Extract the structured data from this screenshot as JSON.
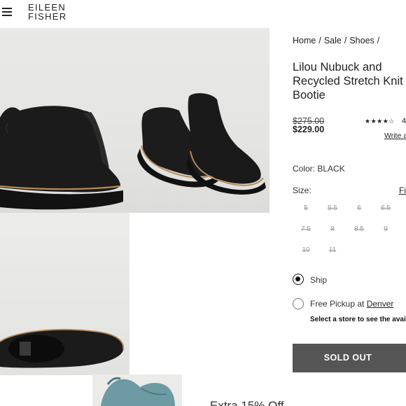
{
  "header": {
    "logo_line1": "EILEEN",
    "logo_line2": "FISHER"
  },
  "breadcrumb": {
    "items": [
      "Home",
      "Sale",
      "Shoes"
    ],
    "separator": "/"
  },
  "product": {
    "title_line1": "Lilou Nubuck and",
    "title_line2": "Recycled Stretch Knit",
    "title_line3": "Bootie",
    "original_price": "$275.00",
    "sale_price": "$229.00",
    "stars": "★★★★☆",
    "rating_count": "4",
    "write_review": "Write a",
    "color_label": "Color:",
    "color_value": "BLACK",
    "size_label": "Size:",
    "fit_link": "Fi",
    "sizes": [
      "5",
      "5.5",
      "6",
      "6.5",
      "7.5",
      "8",
      "8.5",
      "9",
      "10",
      "11"
    ]
  },
  "fulfillment": {
    "ship_label": "Ship",
    "pickup_label": "Free Pickup at",
    "pickup_store": "Denver",
    "store_note": "Select a store to see the avail",
    "selected": "ship"
  },
  "actions": {
    "sold_out_label": "SOLD OUT"
  },
  "promo": {
    "text": "Extra 15% Off"
  },
  "colors": {
    "button_bg": "#555555",
    "text": "#222222",
    "image_bg": "#e6e6e4"
  }
}
